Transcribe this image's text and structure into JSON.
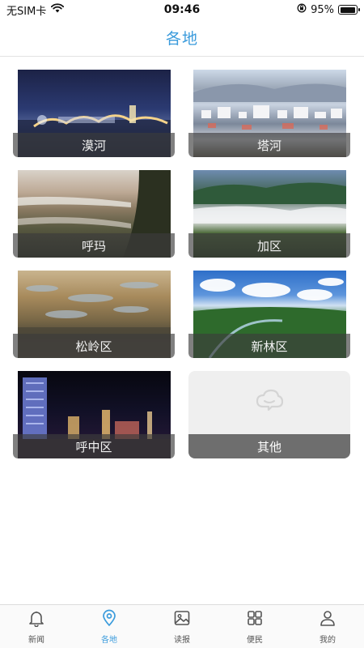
{
  "status_bar": {
    "carrier": "无SIM卡",
    "time": "09:46",
    "battery": "95%",
    "battery_level": 0.95
  },
  "header": {
    "title": "各地"
  },
  "regions": [
    {
      "label": "漠河"
    },
    {
      "label": "塔河"
    },
    {
      "label": "呼玛"
    },
    {
      "label": "加区"
    },
    {
      "label": "松岭区"
    },
    {
      "label": "新林区"
    },
    {
      "label": "呼中区"
    },
    {
      "label": "其他"
    }
  ],
  "tab_bar": {
    "tabs": [
      {
        "label": "新闻",
        "icon": "bell-icon"
      },
      {
        "label": "各地",
        "icon": "location-pin-icon",
        "active": true
      },
      {
        "label": "读报",
        "icon": "image-icon"
      },
      {
        "label": "便民",
        "icon": "grid-icon"
      },
      {
        "label": "我的",
        "icon": "person-icon"
      }
    ]
  },
  "colors": {
    "accent": "#3a9bdc",
    "caption_bg": "#505050",
    "other_card_bg": "#efefef"
  }
}
